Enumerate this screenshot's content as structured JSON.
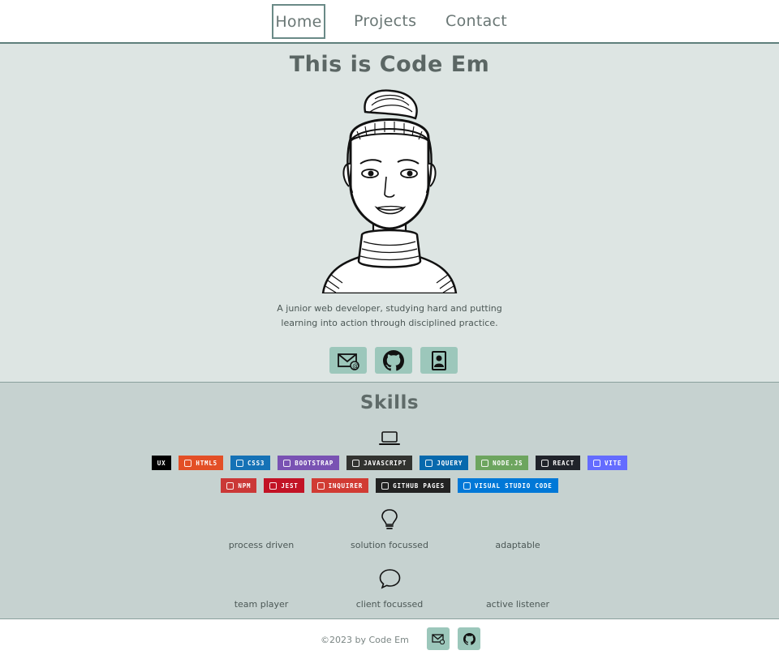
{
  "nav": {
    "home": "Home",
    "projects": "Projects",
    "contact": "Contact"
  },
  "hero": {
    "title": "This is Code Em",
    "description": "A junior web developer, studying hard and putting learning into action through disciplined practice.",
    "buttons": [
      "email-icon",
      "github-icon",
      "contact-card-icon"
    ]
  },
  "skills": {
    "title": "Skills",
    "badges_row1": [
      {
        "label": "UX",
        "color": "#000000"
      },
      {
        "label": "HTML5",
        "color": "#e34f26"
      },
      {
        "label": "CSS3",
        "color": "#1572b6"
      },
      {
        "label": "BOOTSTRAP",
        "color": "#7952b3"
      },
      {
        "label": "JAVASCRIPT",
        "color": "#323330"
      },
      {
        "label": "JQUERY",
        "color": "#0769ad"
      },
      {
        "label": "NODE.JS",
        "color": "#6da55f"
      },
      {
        "label": "REACT",
        "color": "#20232a"
      },
      {
        "label": "VITE",
        "color": "#646cff"
      }
    ],
    "badges_row2": [
      {
        "label": "NPM",
        "color": "#cb3837"
      },
      {
        "label": "JEST",
        "color": "#c21325"
      },
      {
        "label": "INQUIRER",
        "color": "#d13b33"
      },
      {
        "label": "GITHUB PAGES",
        "color": "#222222"
      },
      {
        "label": "VISUAL STUDIO CODE",
        "color": "#0078d7"
      }
    ],
    "traits_row1": [
      "process driven",
      "solution focussed",
      "adaptable"
    ],
    "traits_row2": [
      "team player",
      "client focussed",
      "active listener"
    ]
  },
  "footer": {
    "copyright": "©2023 by Code Em"
  },
  "colors": {
    "accent_button": "#9cc7bb",
    "hero_bg": "#dde5e3",
    "skills_bg": "#c6d2d0"
  }
}
